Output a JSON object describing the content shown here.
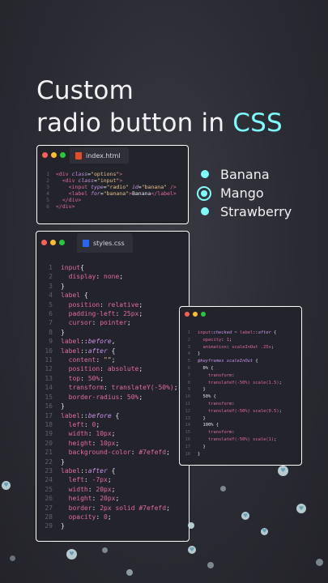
{
  "headline": {
    "line1": "Custom",
    "line2_prefix": "radio button in ",
    "line2_accent": "CSS"
  },
  "colors": {
    "accent": "#7efefd",
    "background": "#2b2b33",
    "dot_red": "#ff5f56",
    "dot_yellow": "#ffbd2e",
    "dot_green": "#27c93f",
    "html_icon": "#e44d26",
    "css_icon": "#2965f1"
  },
  "html_window": {
    "tab_label": "index.html",
    "tab_icon": "html5-icon",
    "lines": [
      {
        "n": "1",
        "html": "<span class=\"tag\">&lt;div</span> <span class=\"attr\">class</span>=<span class=\"str\">\"options\"</span><span class=\"tag\">&gt;</span>"
      },
      {
        "n": "2",
        "html": "  <span class=\"tag\">&lt;div</span> <span class=\"attr\">class</span>=<span class=\"str\">\"input\"</span><span class=\"tag\">&gt;</span>"
      },
      {
        "n": "3",
        "html": "    <span class=\"tag\">&lt;input</span> <span class=\"attr\">type</span>=<span class=\"str\">\"radio\"</span> <span class=\"attr\">id</span>=<span class=\"str\">\"banana\"</span> <span class=\"tag\">/&gt;</span>"
      },
      {
        "n": "4",
        "html": "    <span class=\"tag\">&lt;label</span> <span class=\"attr\">for</span>=<span class=\"str\">\"banana\"</span><span class=\"tag\">&gt;</span>Banana<span class=\"tag\">&lt;/label&gt;</span>"
      },
      {
        "n": "5",
        "html": "  <span class=\"tag\">&lt;/div&gt;</span>"
      },
      {
        "n": "6",
        "html": "<span class=\"tag\">&lt;/div&gt;</span>"
      }
    ]
  },
  "css_window": {
    "tab_label": "styles.css",
    "tab_icon": "css3-icon",
    "lines": [
      {
        "n": "1",
        "html": "<span class=\"sel\">input</span>{"
      },
      {
        "n": "2",
        "html": "  <span class=\"prop\">display</span>: <span class=\"val\">none</span>;"
      },
      {
        "n": "3",
        "html": "}"
      },
      {
        "n": "4",
        "html": "<span class=\"sel\">label</span> {"
      },
      {
        "n": "5",
        "html": "  <span class=\"prop\">position</span>: <span class=\"val\">relative</span>;"
      },
      {
        "n": "6",
        "html": "  <span class=\"prop\">padding-left</span>: <span class=\"num\">25px</span>;"
      },
      {
        "n": "7",
        "html": "  <span class=\"prop\">cursor</span>: <span class=\"val\">pointer</span>;"
      },
      {
        "n": "8",
        "html": "}"
      },
      {
        "n": "9",
        "html": "<span class=\"sel\">label</span>::<span class=\"pc\">before</span>,"
      },
      {
        "n": "10",
        "html": "<span class=\"sel\">label</span>::<span class=\"pc\">after</span> {"
      },
      {
        "n": "11",
        "html": "  <span class=\"prop\">content</span>: <span class=\"str\">\"\"</span>;"
      },
      {
        "n": "12",
        "html": "  <span class=\"prop\">position</span>: <span class=\"val\">absolute</span>;"
      },
      {
        "n": "13",
        "html": "  <span class=\"prop\">top</span>: <span class=\"num\">50%</span>;"
      },
      {
        "n": "14",
        "html": "  <span class=\"prop\">transform</span>: <span class=\"val\">translateY(-50%)</span>;"
      },
      {
        "n": "15",
        "html": "  <span class=\"prop\">border-radius</span>: <span class=\"num\">50%</span>;"
      },
      {
        "n": "16",
        "html": "}"
      },
      {
        "n": "17",
        "html": "<span class=\"sel\">label</span>::<span class=\"pc\">before</span> {"
      },
      {
        "n": "18",
        "html": "  <span class=\"prop\">left</span>: <span class=\"num\">0</span>;"
      },
      {
        "n": "19",
        "html": "  <span class=\"prop\">width</span>: <span class=\"num\">10px</span>;"
      },
      {
        "n": "20",
        "html": "  <span class=\"prop\">height</span>: <span class=\"num\">10px</span>;"
      },
      {
        "n": "21",
        "html": "  <span class=\"prop\">background-color</span>: <span class=\"num\">#7efefd</span>;"
      },
      {
        "n": "22",
        "html": "}"
      },
      {
        "n": "23",
        "html": "<span class=\"sel\">label</span>::<span class=\"pc\">after</span> {"
      },
      {
        "n": "24",
        "html": "  <span class=\"prop\">left</span>: <span class=\"num\">-7px</span>;"
      },
      {
        "n": "25",
        "html": "  <span class=\"prop\">width</span>: <span class=\"num\">20px</span>;"
      },
      {
        "n": "26",
        "html": "  <span class=\"prop\">height</span>: <span class=\"num\">20px</span>;"
      },
      {
        "n": "27",
        "html": "  <span class=\"prop\">border</span>: <span class=\"num\">2px solid #7efefd</span>;"
      },
      {
        "n": "28",
        "html": "  <span class=\"prop\">opacity</span>: <span class=\"num\">0</span>;"
      },
      {
        "n": "29",
        "html": "}"
      }
    ]
  },
  "anim_window": {
    "lines": [
      {
        "n": "1",
        "html": "<span class=\"sel\">input</span>:<span class=\"pc\">checked</span> ~ <span class=\"sel\">label</span>::<span class=\"pc\">after</span> {"
      },
      {
        "n": "2",
        "html": "  <span class=\"prop\">opacity</span>: <span class=\"num\">1</span>;"
      },
      {
        "n": "3",
        "html": "  <span class=\"prop\">animation</span>: <span class=\"val\">scaleInOut .25s</span>;"
      },
      {
        "n": "4",
        "html": "}"
      },
      {
        "n": "5",
        "html": "<span class=\"pc\">@keyframes scaleInOut</span> {"
      },
      {
        "n": "6",
        "html": "  0% {"
      },
      {
        "n": "7",
        "html": "    <span class=\"prop\">transform</span>:"
      },
      {
        "n": "8",
        "html": "    <span class=\"val\">translateY(-50%) scale(1.5)</span>;"
      },
      {
        "n": "9",
        "html": "  }"
      },
      {
        "n": "10",
        "html": "  50% {"
      },
      {
        "n": "11",
        "html": "    <span class=\"prop\">transform</span>:"
      },
      {
        "n": "12",
        "html": "    <span class=\"val\">translateY(-50%) scale(0.5)</span>;"
      },
      {
        "n": "13",
        "html": "  }"
      },
      {
        "n": "14",
        "html": "  100% {"
      },
      {
        "n": "15",
        "html": "    <span class=\"prop\">transform</span>:"
      },
      {
        "n": "16",
        "html": "    <span class=\"val\">translateY(-50%) scale(1)</span>;"
      },
      {
        "n": "17",
        "html": "  }"
      },
      {
        "n": "18",
        "html": "}"
      }
    ]
  },
  "radio_options": [
    {
      "label": "Banana",
      "checked": false
    },
    {
      "label": "Mango",
      "checked": true
    },
    {
      "label": "Strawberry",
      "checked": false
    }
  ]
}
